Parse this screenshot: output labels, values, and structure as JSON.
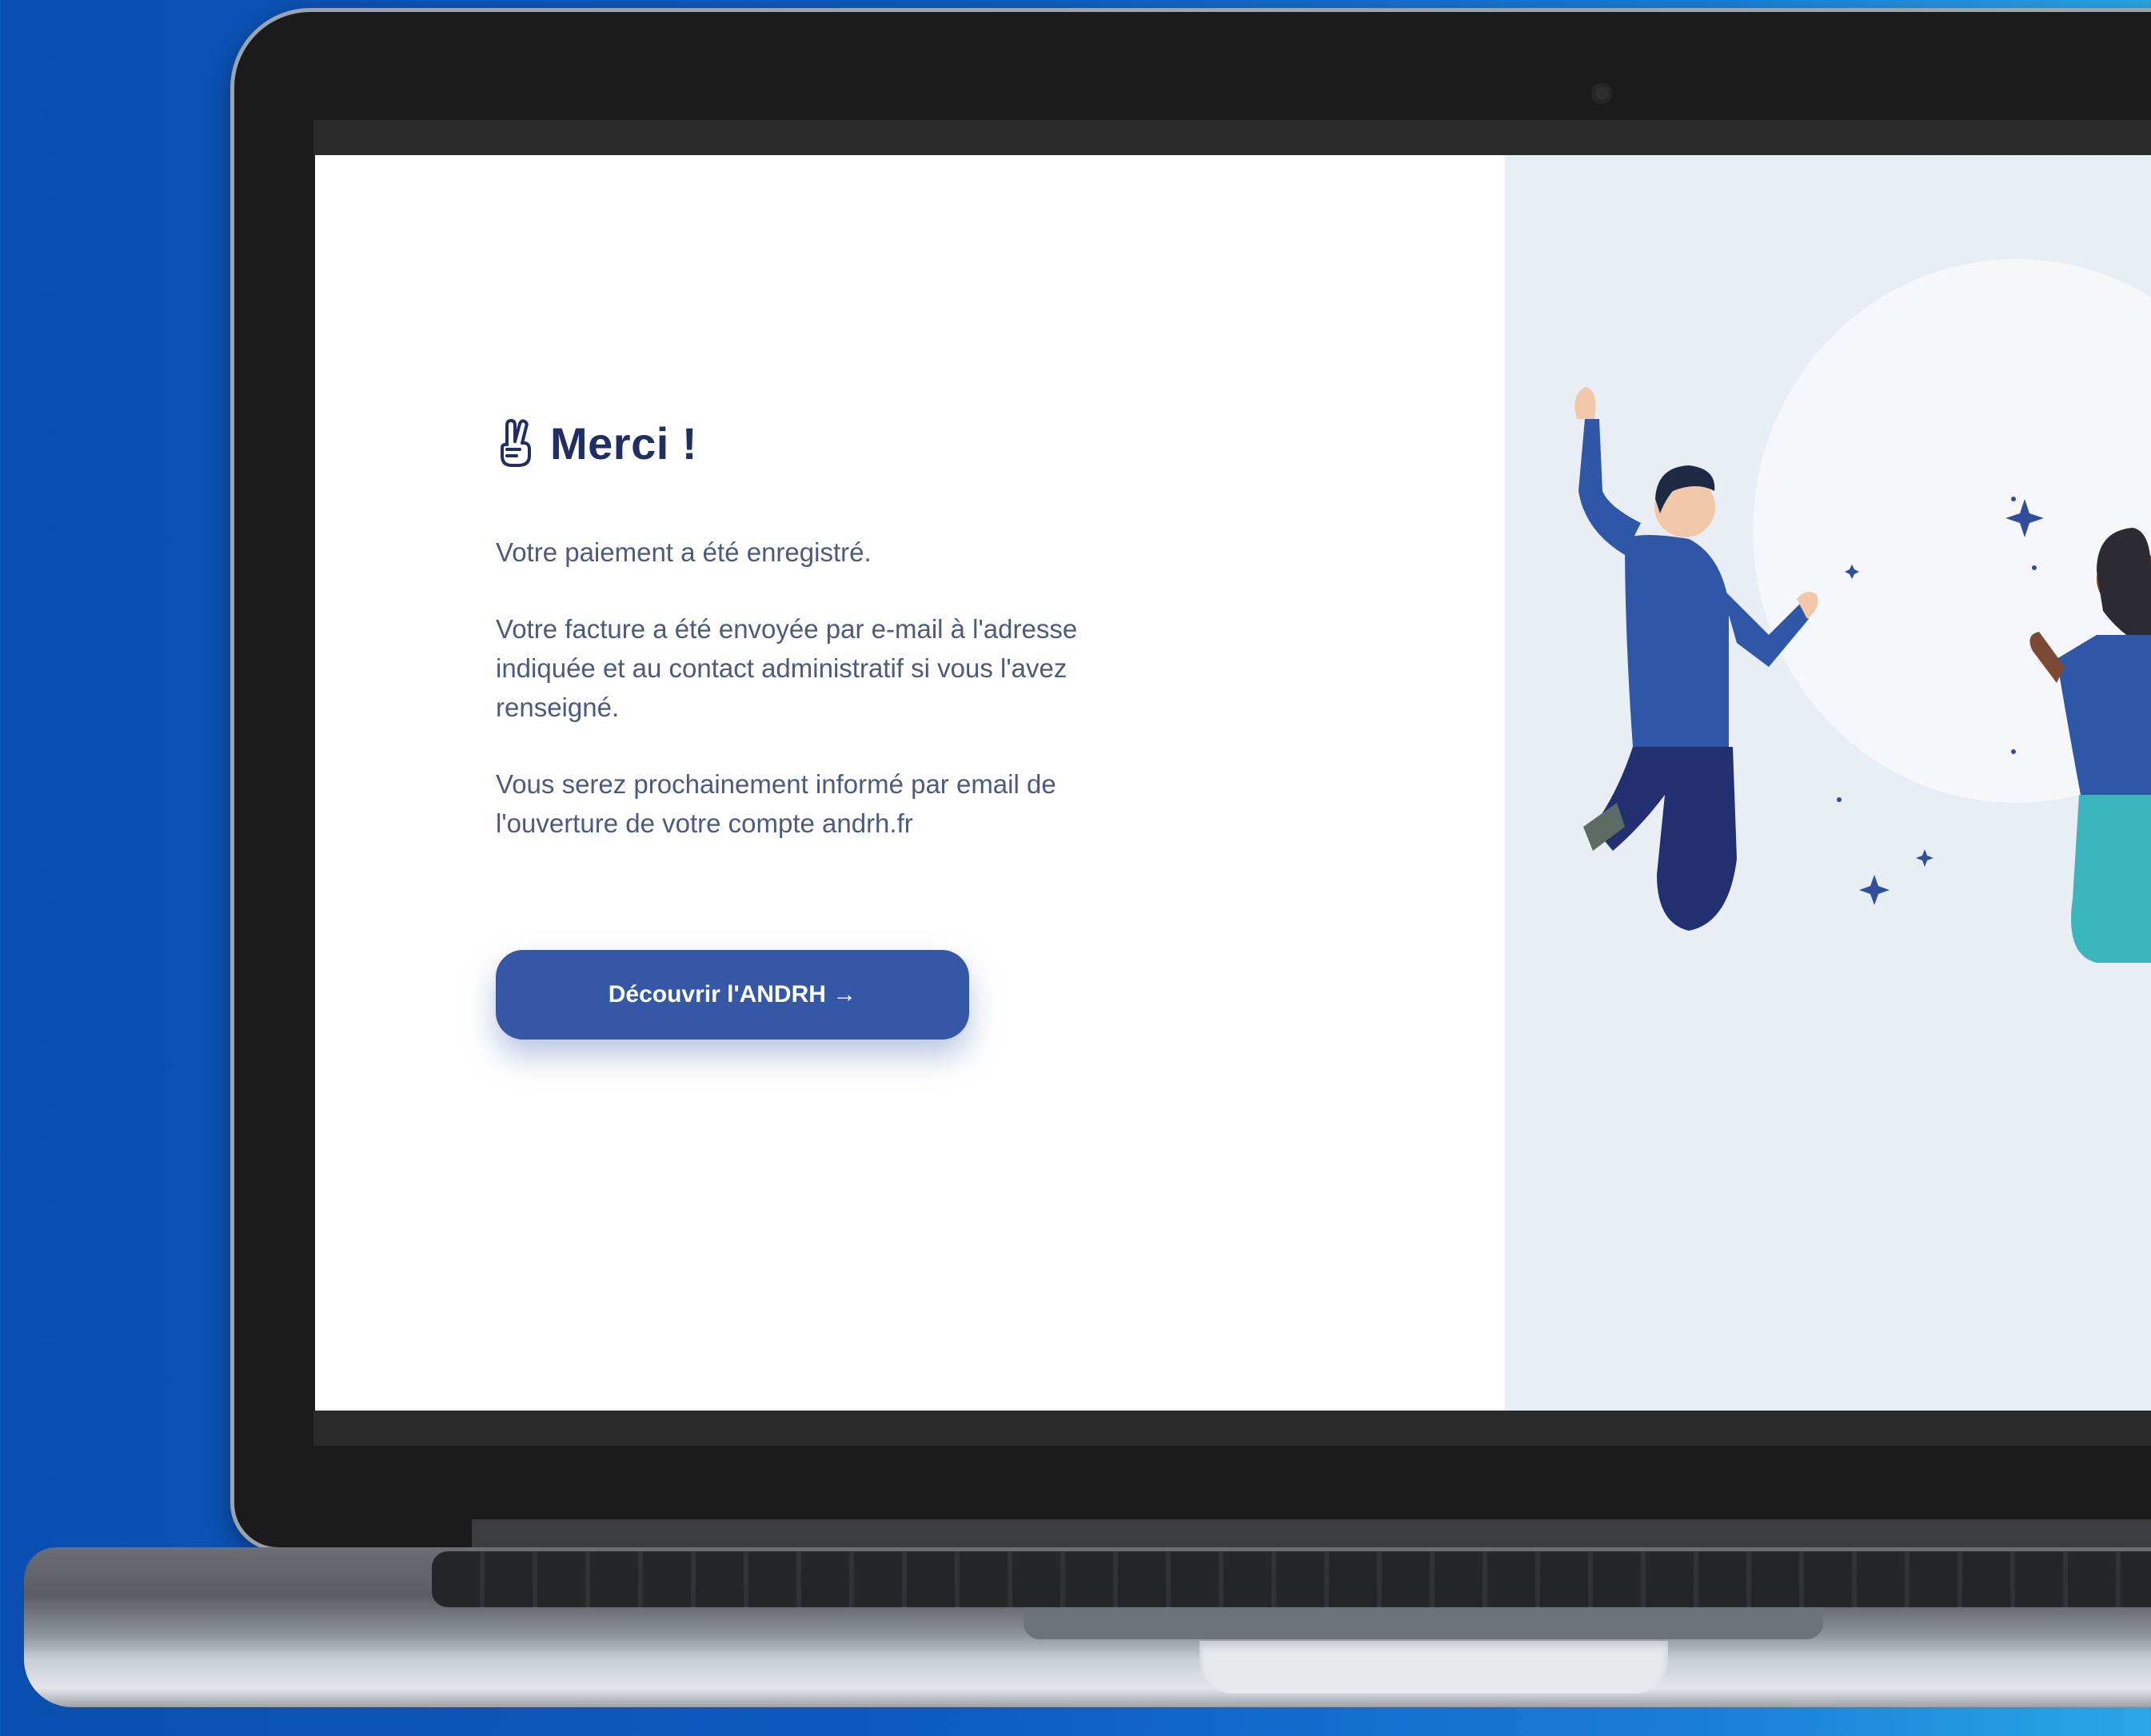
{
  "page": {
    "title": "Merci !",
    "paragraphs": [
      "Votre paiement a été enregistré.",
      "Votre facture a été envoyée par e-mail à l'adresse indiquée et au contact administratif si vous l'avez renseigné.",
      "Vous serez prochainement informé par email de l'ouverture de votre compte andrh.fr"
    ],
    "cta_label": "Découvrir l'ANDRH →"
  },
  "icons": {
    "title_icon": "fingers-crossed-hand-icon"
  },
  "colors": {
    "title": "#1f2f63",
    "body_text": "#4b5a7d",
    "button": "#3458a6",
    "right_panel": "#e9edf4",
    "background_gradient_start": "#0a4fb0",
    "background_gradient_end": "#2aa6e6"
  }
}
